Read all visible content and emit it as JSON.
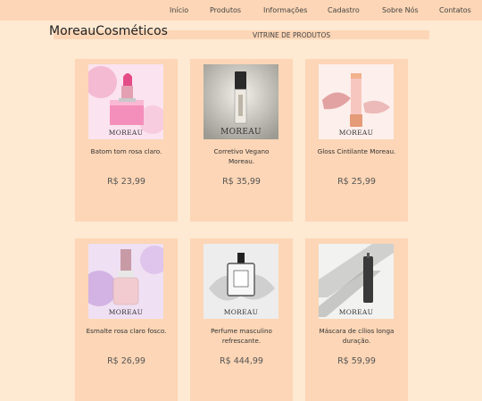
{
  "nav": {
    "items": [
      {
        "label": "Início",
        "name": "nav-inicio"
      },
      {
        "label": "Produtos",
        "name": "nav-produtos"
      },
      {
        "label": "Informações",
        "name": "nav-informacoes"
      },
      {
        "label": "Cadastro",
        "name": "nav-cadastro"
      },
      {
        "label": "Sobre Nós",
        "name": "nav-sobre-nos"
      },
      {
        "label": "Contatos",
        "name": "nav-contatos"
      }
    ]
  },
  "header": {
    "brand": "MoreauCosméticos",
    "page_title": "VITRINE DE PRODUTOS"
  },
  "products": [
    {
      "name": "Batom tom rosa claro.",
      "price": "R$ 23,99",
      "watermark": "MOREAU",
      "icon": "lipstick-image"
    },
    {
      "name": "Corretivo Vegano Moreau.",
      "price": "R$ 35,99",
      "watermark": "MOREAU",
      "icon": "concealer-image"
    },
    {
      "name": "Gloss Cintilante Moreau.",
      "price": "R$ 25,99",
      "watermark": "MOREAU",
      "icon": "lip-gloss-image"
    },
    {
      "name": "Esmalte rosa claro fosco.",
      "price": "R$ 26,99",
      "watermark": "MOREAU",
      "icon": "nail-polish-image"
    },
    {
      "name": "Perfume masculino refrescante.",
      "price": "R$ 444,99",
      "watermark": "MOREAU",
      "icon": "perfume-image"
    },
    {
      "name": "Máscara de cílios longa duração.",
      "price": "R$ 59,99",
      "watermark": "MOREAU",
      "icon": "mascara-image"
    }
  ],
  "colors": {
    "background": "#fee9d2",
    "nav_bar": "#fcd6b6",
    "card": "#fcd6b6"
  }
}
